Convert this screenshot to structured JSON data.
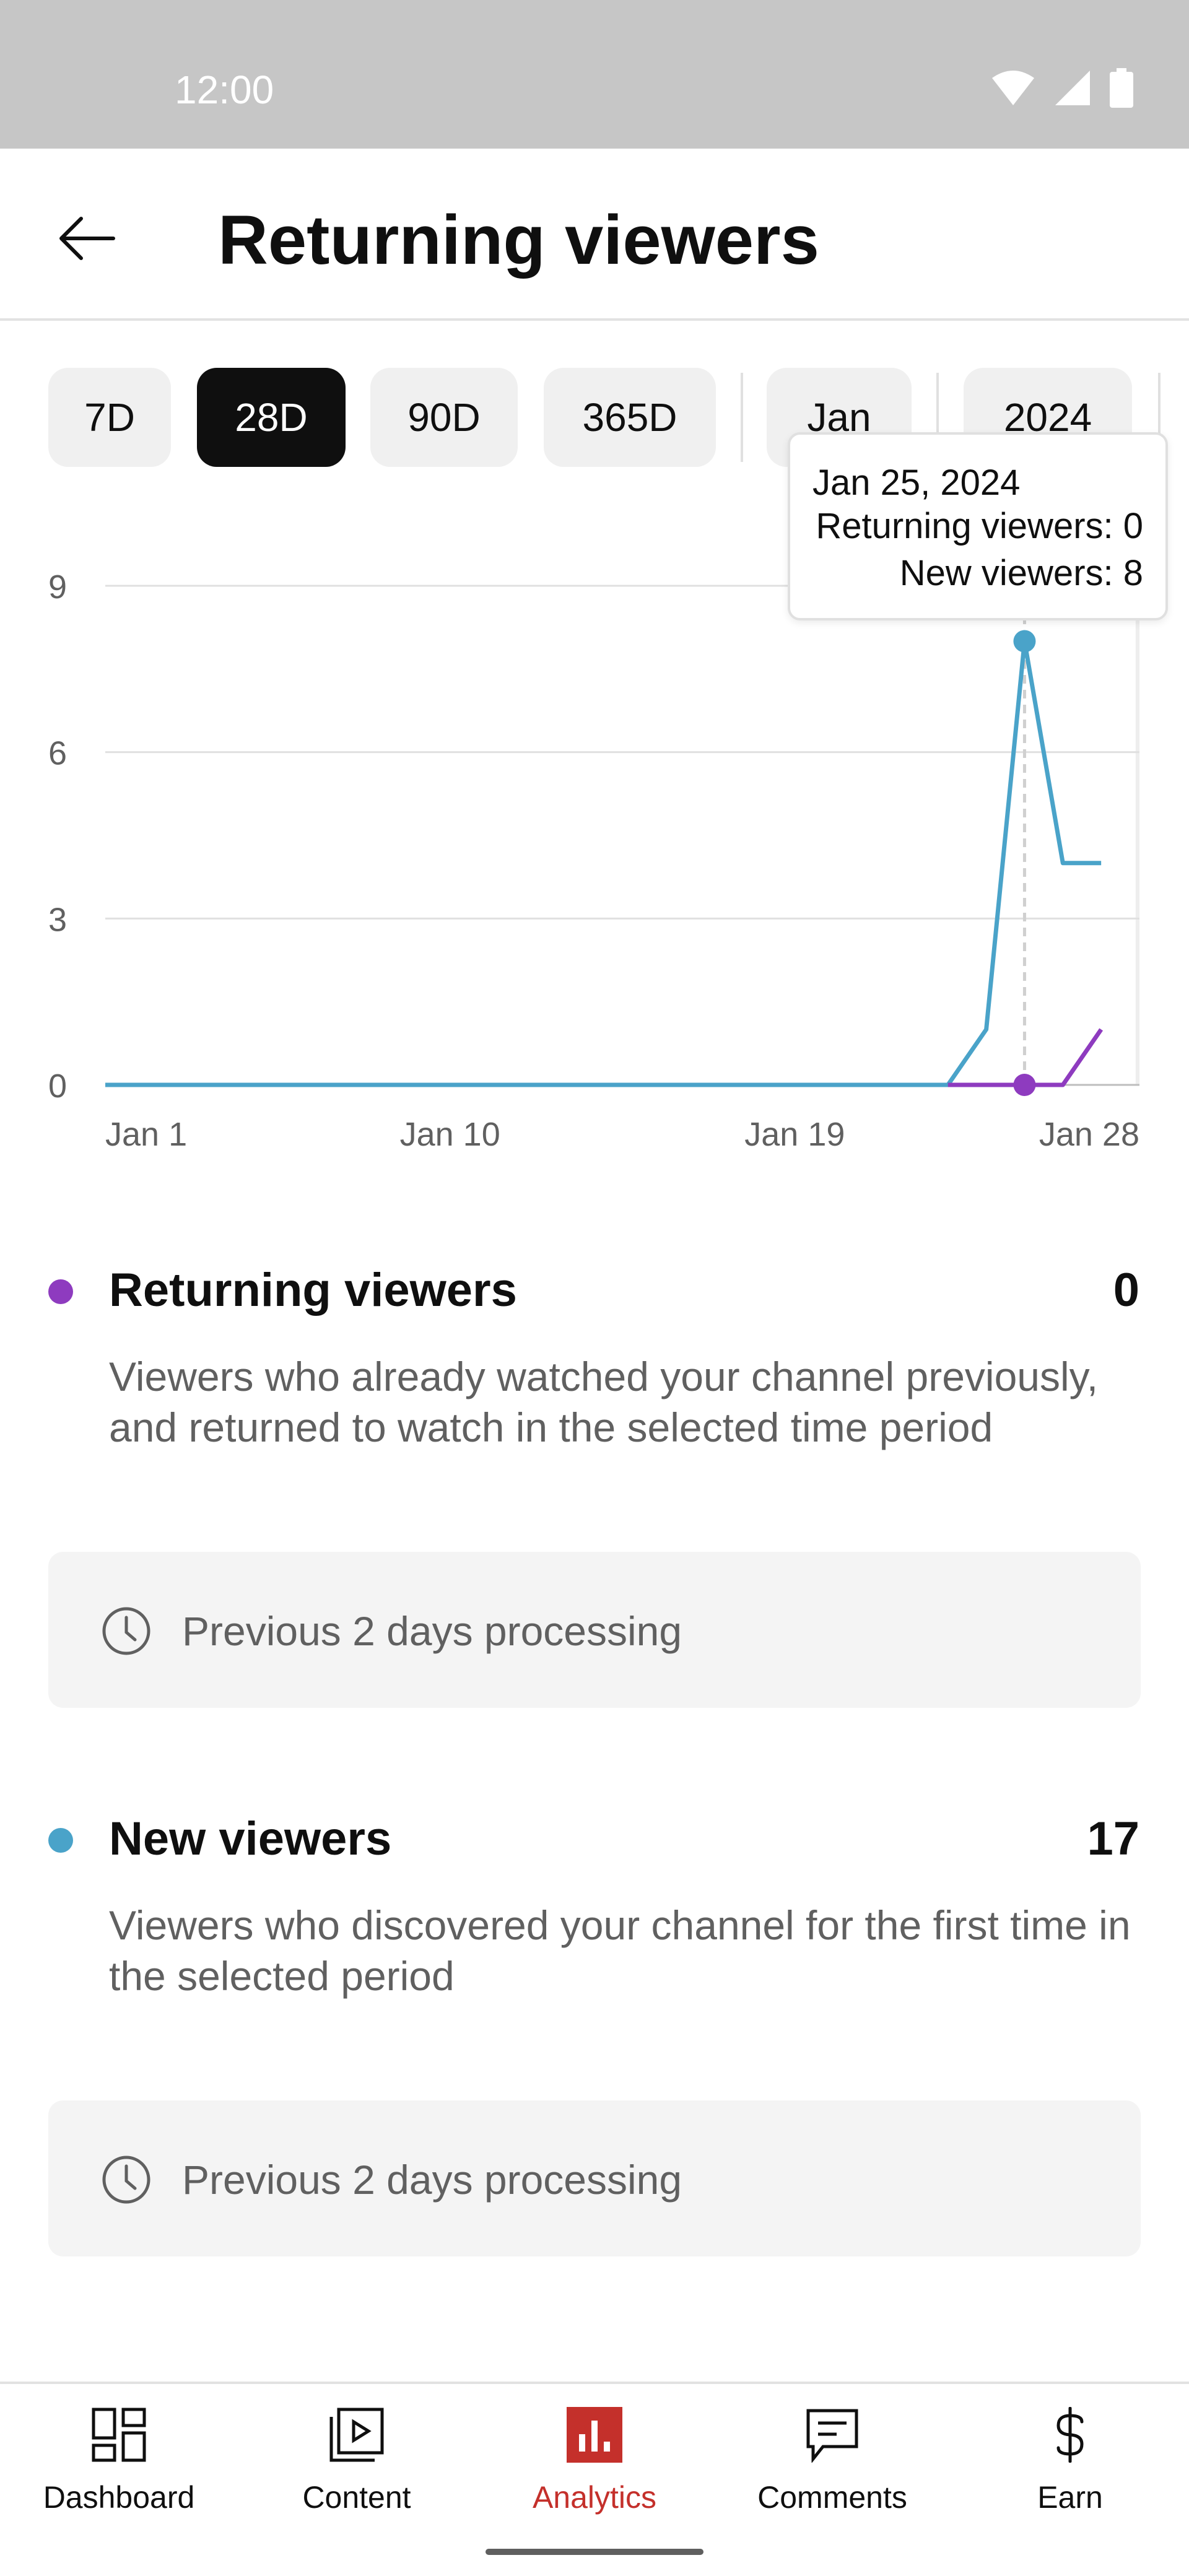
{
  "status_bar": {
    "time": "12:00"
  },
  "app_bar": {
    "title": "Returning viewers"
  },
  "chips": [
    {
      "label": "7D",
      "selected": false
    },
    {
      "label": "28D",
      "selected": true
    },
    {
      "label": "90D",
      "selected": false
    },
    {
      "label": "365D",
      "selected": false
    },
    {
      "label": "Jan",
      "selected": false
    },
    {
      "label": "2024",
      "selected": false
    }
  ],
  "tooltip": {
    "date": "Jan 25, 2024",
    "returning": "Returning viewers: 0",
    "new": "New viewers: 8"
  },
  "colors": {
    "returning": "#8e3bbf",
    "new": "#4aa3c9",
    "active_nav": "#c4302b"
  },
  "chart_data": {
    "type": "line",
    "x": [
      "Jan 1",
      "Jan 2",
      "Jan 3",
      "Jan 4",
      "Jan 5",
      "Jan 6",
      "Jan 7",
      "Jan 8",
      "Jan 9",
      "Jan 10",
      "Jan 11",
      "Jan 12",
      "Jan 13",
      "Jan 14",
      "Jan 15",
      "Jan 16",
      "Jan 17",
      "Jan 18",
      "Jan 19",
      "Jan 20",
      "Jan 21",
      "Jan 22",
      "Jan 23",
      "Jan 24",
      "Jan 25",
      "Jan 26",
      "Jan 27",
      "Jan 28"
    ],
    "x_ticks": [
      "Jan 1",
      "Jan 10",
      "Jan 19",
      "Jan 28"
    ],
    "y_ticks": [
      0,
      3,
      6,
      9
    ],
    "ylim": [
      0,
      9
    ],
    "grid": true,
    "highlighted": "Jan 25",
    "shaded_processing_days": [
      "Jan 27",
      "Jan 28"
    ],
    "series": [
      {
        "name": "New viewers",
        "values": [
          0,
          0,
          0,
          0,
          0,
          0,
          0,
          0,
          0,
          0,
          0,
          0,
          0,
          0,
          0,
          0,
          0,
          0,
          0,
          0,
          0,
          0,
          0,
          1,
          8,
          4,
          4,
          null
        ]
      },
      {
        "name": "Returning viewers",
        "values": [
          null,
          null,
          null,
          null,
          null,
          null,
          null,
          null,
          null,
          null,
          null,
          null,
          null,
          null,
          null,
          null,
          null,
          null,
          null,
          null,
          null,
          null,
          0,
          0,
          0,
          0,
          1,
          null
        ]
      }
    ]
  },
  "metrics": [
    {
      "name": "Returning viewers",
      "value": "0",
      "description": "Viewers who already watched your channel previously, and returned to watch in the selected time period",
      "processing": "Previous 2 days processing"
    },
    {
      "name": "New viewers",
      "value": "17",
      "description": "Viewers who discovered your channel for the first time in the selected period",
      "processing": "Previous 2 days processing"
    }
  ],
  "bottom_nav": [
    {
      "label": "Dashboard",
      "icon": "dashboard-icon",
      "active": false
    },
    {
      "label": "Content",
      "icon": "content-icon",
      "active": false
    },
    {
      "label": "Analytics",
      "icon": "analytics-icon",
      "active": true
    },
    {
      "label": "Comments",
      "icon": "comments-icon",
      "active": false
    },
    {
      "label": "Earn",
      "icon": "dollar-icon",
      "active": false
    }
  ]
}
